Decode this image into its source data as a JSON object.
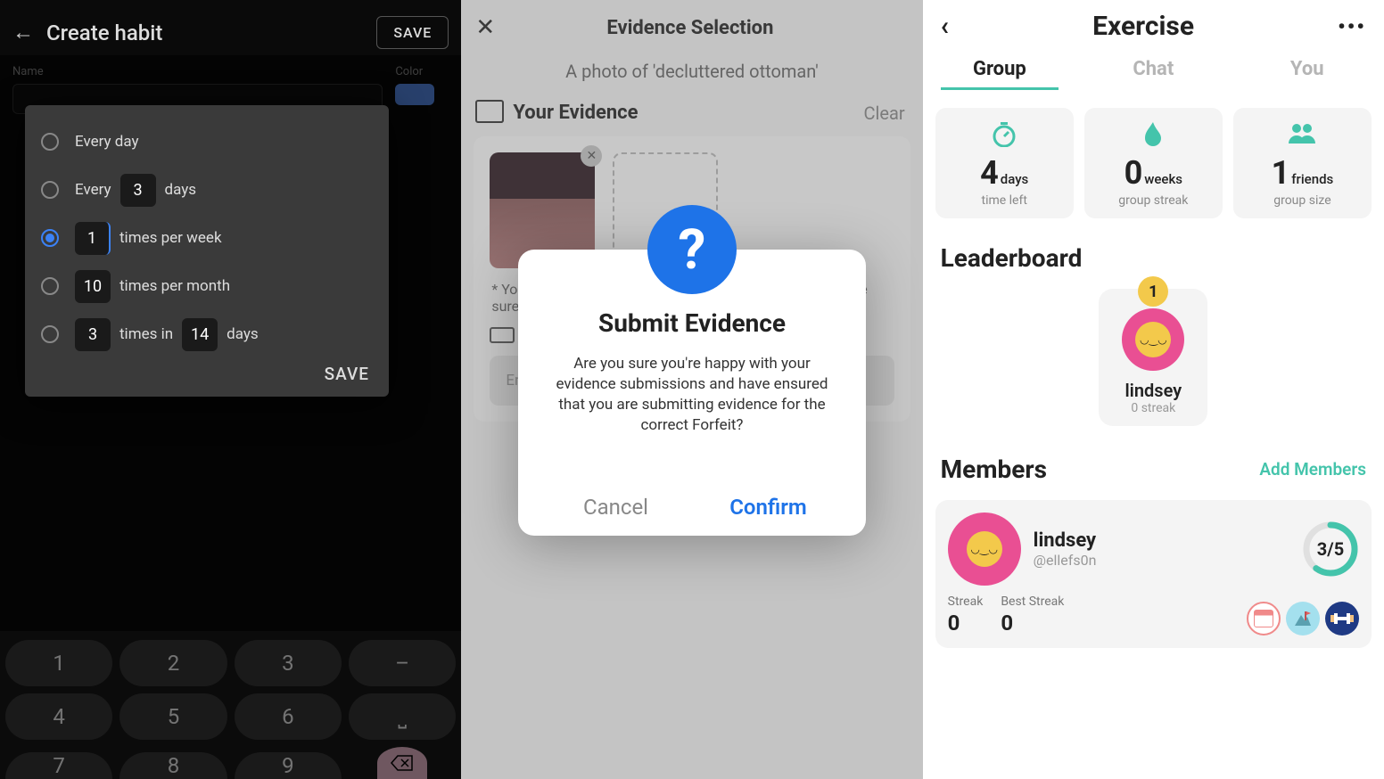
{
  "screen1": {
    "title": "Create habit",
    "saveTop": "SAVE",
    "labels": {
      "name": "Name",
      "color": "Color"
    },
    "popup": {
      "opt1": "Every day",
      "opt2_pre": "Every",
      "opt2_val": "3",
      "opt2_post": "days",
      "opt3_val": "1",
      "opt3_post": "times per week",
      "opt4_val": "10",
      "opt4_post": "times per month",
      "opt5_val": "3",
      "opt5_mid": "times in",
      "opt5_val2": "14",
      "opt5_post": "days",
      "save": "SAVE"
    },
    "keys": {
      "k1": "1",
      "k2": "2",
      "k3": "3",
      "k4": "4",
      "k5": "5",
      "k6": "6",
      "k7": "7",
      "k8": "8",
      "k9": "9",
      "dash": "–",
      "us": "⎵"
    }
  },
  "screen2": {
    "title": "Evidence Selection",
    "subtitle": "A photo of 'decluttered ottoman'",
    "yourEvidence": "Your Evidence",
    "clear": "Clear",
    "note": "* You can only submit each photo once per Forfeit, so make sure you pick a good one!",
    "inputPh": "Enter any notes",
    "modal": {
      "title": "Submit Evidence",
      "message": "Are you sure you're happy with your evidence submissions and have ensured that you are submitting evidence for the correct Forfeit?",
      "cancel": "Cancel",
      "confirm": "Confirm"
    }
  },
  "screen3": {
    "title": "Exercise",
    "tabs": {
      "group": "Group",
      "chat": "Chat",
      "you": "You"
    },
    "stats": {
      "time": {
        "num": "4",
        "unit": "days",
        "caption": "time left"
      },
      "streak": {
        "num": "0",
        "unit": "weeks",
        "caption": "group streak"
      },
      "size": {
        "num": "1",
        "unit": "friends",
        "caption": "group size"
      }
    },
    "leaderboard": {
      "title": "Leaderboard",
      "rank": "1",
      "name": "lindsey",
      "sub": "0 streak"
    },
    "members": {
      "title": "Members",
      "add": "Add Members",
      "item": {
        "name": "lindsey",
        "handle": "@ellefs0n",
        "progress": "3/5",
        "streakCap": "Streak",
        "streakVal": "0",
        "bestCap": "Best Streak",
        "bestVal": "0"
      }
    }
  }
}
